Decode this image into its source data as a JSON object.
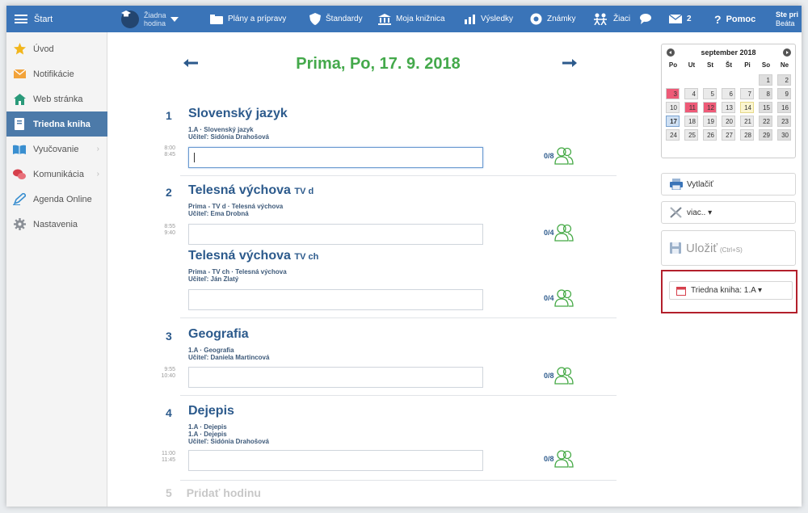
{
  "topbar": {
    "start": "Štart",
    "hodina_line1": "Žiadna",
    "hodina_line2": "hodina",
    "plany": "Plány a prípravy",
    "standardy": "Štandardy",
    "kniznica": "Moja knižnica",
    "vysledky": "Výsledky",
    "znamky": "Známky",
    "ziaci": "Žiaci",
    "mail_count": "2",
    "pomoc": "Pomoc",
    "user_line1": "Ste pri",
    "user_line2": "Beáta"
  },
  "sidebar": {
    "items": [
      {
        "label": "Úvod"
      },
      {
        "label": "Notifikácie"
      },
      {
        "label": "Web stránka"
      },
      {
        "label": "Triedna kniha"
      },
      {
        "label": "Vyučovanie"
      },
      {
        "label": "Komunikácia"
      },
      {
        "label": "Agenda Online"
      },
      {
        "label": "Nastavenia"
      }
    ]
  },
  "main": {
    "title": "Prima, Po, 17. 9. 2018",
    "lessons": [
      {
        "num": "1",
        "name": "Slovenský jazyk",
        "group": "",
        "meta1": "1.A · Slovenský jazyk",
        "meta2": "Učiteľ:  Sidónia Drahošová",
        "time_from": "8:00",
        "time_to": "8:45",
        "attendance": "0/8"
      },
      {
        "num": "2",
        "name": "Telesná výchova",
        "group": "TV d",
        "meta1": "Prima - TV d · Telesná výchova",
        "meta2": "Učiteľ:  Ema Drobná",
        "time_from": "8:55",
        "time_to": "9:40",
        "attendance": "0/4"
      },
      {
        "num": "",
        "name": "Telesná výchova",
        "group": "TV ch",
        "meta1": "Prima - TV ch · Telesná výchova",
        "meta2": "Učiteľ:  Ján Zlatý",
        "time_from": "",
        "time_to": "",
        "attendance": "0/4"
      },
      {
        "num": "3",
        "name": "Geografia",
        "group": "",
        "meta1": "1.A · Geografia",
        "meta2": "Učiteľ:  Daniela Martincová",
        "time_from": "9:55",
        "time_to": "10:40",
        "attendance": "0/8"
      },
      {
        "num": "4",
        "name": "Dejepis",
        "group": "",
        "meta1": "1.A · Dejepis",
        "meta1b": "1.A · Dejepis",
        "meta2": "Učiteľ:  Sidónia Drahošová",
        "time_from": "11:00",
        "time_to": "11:45",
        "attendance": "0/8"
      }
    ],
    "add_num": "5",
    "add_label": "Pridať hodinu"
  },
  "calendar": {
    "month": "september 2018",
    "weekdays": [
      "Po",
      "Ut",
      "St",
      "Št",
      "Pi",
      "So",
      "Ne"
    ],
    "days": [
      "1",
      "2",
      "3",
      "4",
      "5",
      "6",
      "7",
      "8",
      "9",
      "10",
      "11",
      "12",
      "13",
      "14",
      "15",
      "16",
      "17",
      "18",
      "19",
      "20",
      "21",
      "22",
      "23",
      "24",
      "25",
      "26",
      "27",
      "28",
      "29",
      "30"
    ]
  },
  "right": {
    "print": "Vytlačiť",
    "more": "viac.. ▾",
    "save": "Uložiť",
    "save_hint": "(Ctrl+S)",
    "class_book": "Triedna kniha: 1.A ▾"
  },
  "colors": {
    "nav": "#3a74b8",
    "title_green": "#44a94b",
    "lesson_blue": "#2c5a8c",
    "highlight_red": "#b3202c",
    "calendar_red": "#ee5a77"
  }
}
